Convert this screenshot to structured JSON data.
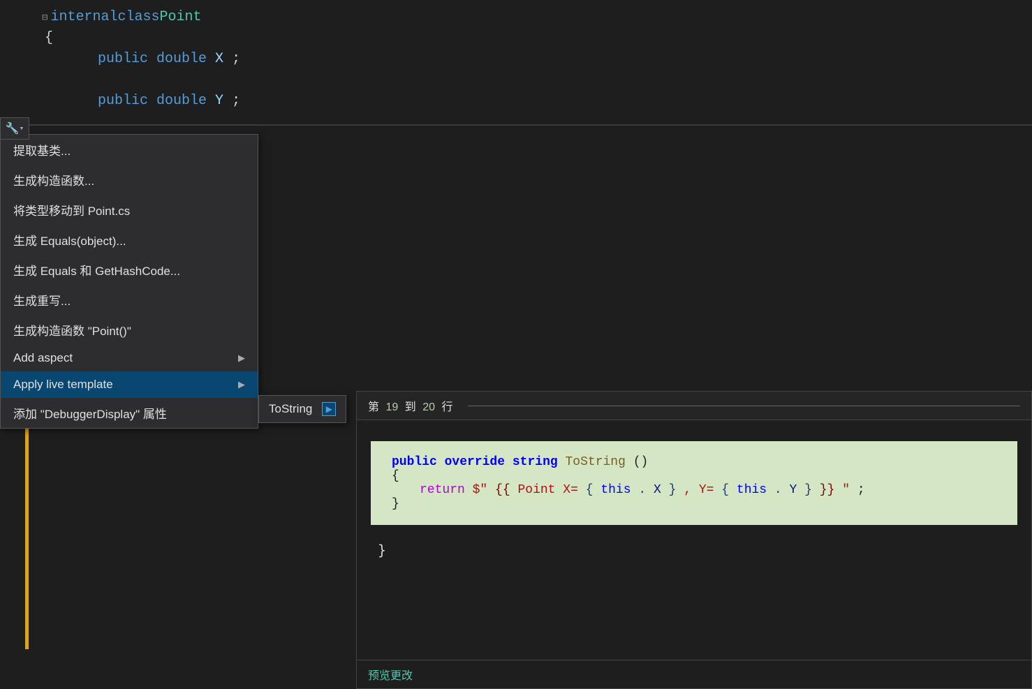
{
  "editor": {
    "code_lines": [
      {
        "indent": "",
        "collapse": "⊟",
        "parts": [
          {
            "text": "internal ",
            "class": "kw-blue"
          },
          {
            "text": "class ",
            "class": "kw-blue"
          },
          {
            "text": "Point",
            "class": "kw-cyan"
          }
        ]
      },
      {
        "indent": "    ",
        "collapse": "",
        "parts": [
          {
            "text": "{",
            "class": "kw-white"
          }
        ]
      },
      {
        "indent": "        ",
        "collapse": "",
        "parts": [
          {
            "text": "public ",
            "class": "kw-blue"
          },
          {
            "text": "double ",
            "class": "kw-blue"
          },
          {
            "text": "X;",
            "class": "kw-white"
          }
        ]
      },
      {
        "indent": "",
        "collapse": "",
        "parts": []
      },
      {
        "indent": "        ",
        "collapse": "",
        "parts": [
          {
            "text": "public ",
            "class": "kw-blue"
          },
          {
            "text": "double ",
            "class": "kw-blue"
          },
          {
            "text": "Y;",
            "class": "kw-white"
          }
        ]
      }
    ]
  },
  "context_menu": {
    "items": [
      {
        "label": "提取基类...",
        "has_submenu": false,
        "active": false
      },
      {
        "label": "生成构造函数...",
        "has_submenu": false,
        "active": false
      },
      {
        "label": "将类型移动到 Point.cs",
        "has_submenu": false,
        "active": false
      },
      {
        "label": "生成 Equals(object)...",
        "has_submenu": false,
        "active": false
      },
      {
        "label": "生成 Equals 和 GetHashCode...",
        "has_submenu": false,
        "active": false
      },
      {
        "label": "生成重写...",
        "has_submenu": false,
        "active": false
      },
      {
        "label": "生成构造函数 \"Point()\"",
        "has_submenu": false,
        "active": false
      },
      {
        "label": "Add aspect",
        "has_submenu": true,
        "active": false
      },
      {
        "label": "Apply live template",
        "has_submenu": true,
        "active": true
      },
      {
        "label": "添加 \"DebuggerDisplay\" 属性",
        "has_submenu": false,
        "active": false
      }
    ]
  },
  "submenu": {
    "item_label": "ToString",
    "arrow_icon": "▶"
  },
  "preview": {
    "header_text": "第",
    "line_start": "19",
    "separator": "到",
    "line_end": "20",
    "suffix": "行",
    "code": {
      "line1": "    public override string ToString()",
      "line2": "    {",
      "line3": "        return $\"{{ Point X={this.X}, Y={this.Y} }}\";",
      "line4": "    }"
    },
    "closing_brace": "}",
    "footer_link": "预览更改"
  },
  "wrench": {
    "icon": "🔧",
    "arrow": "▾"
  }
}
